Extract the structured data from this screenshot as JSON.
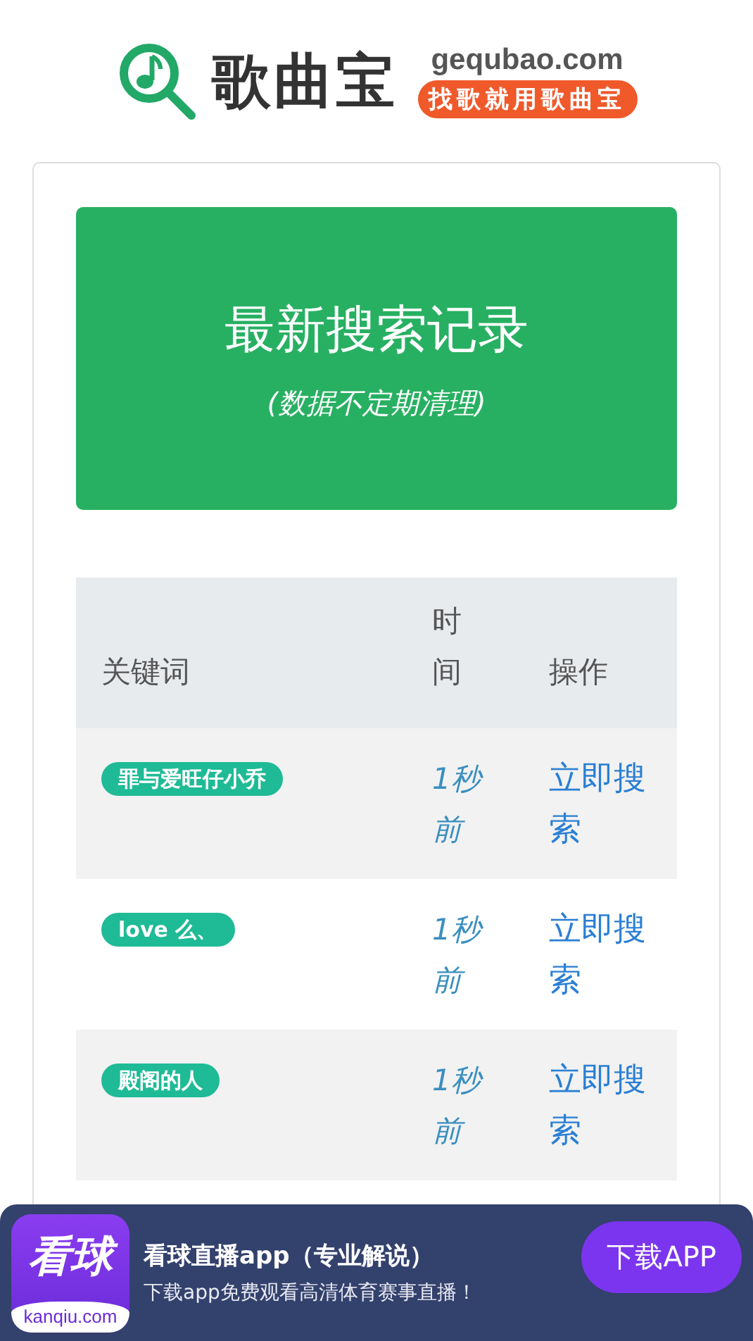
{
  "header": {
    "logo_text": "歌曲宝",
    "domain": "gequbao.com",
    "slogan": "找歌就用歌曲宝"
  },
  "banner": {
    "title": "最新搜索记录",
    "subtitle": "(数据不定期清理)"
  },
  "table": {
    "columns": [
      "关键词",
      "时间",
      "操作"
    ],
    "rows": [
      {
        "keyword": "罪与爱旺仔小乔",
        "time": "1秒前",
        "action": "立即搜索"
      },
      {
        "keyword": "love 么、",
        "time": "1秒前",
        "action": "立即搜索"
      },
      {
        "keyword": "殿阁的人",
        "time": "1秒前",
        "action": "立即搜索"
      }
    ]
  },
  "ad": {
    "icon_text": "看球",
    "icon_domain": "kanqiu.com",
    "title": "看球直播app（专业解说）",
    "subtitle": "下载app免费观看高清体育赛事直播！",
    "button": "下载APP"
  }
}
